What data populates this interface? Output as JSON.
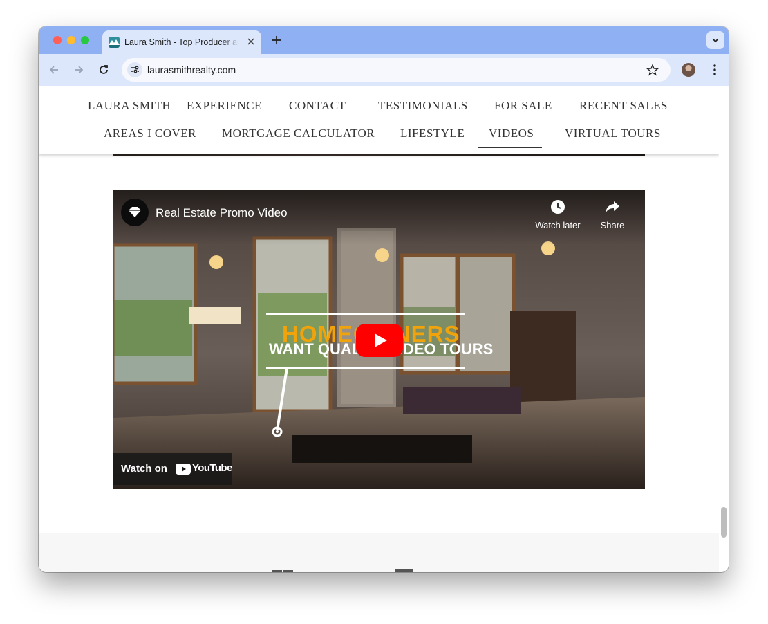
{
  "browser": {
    "tab": {
      "title": "Laura Smith - Top Producer and Real Estate Agent"
    },
    "address_bar": {
      "url": "laurasmithrealty.com"
    }
  },
  "site_nav": {
    "row1": [
      "LAURA SMITH",
      "EXPERIENCE",
      "CONTACT",
      "TESTIMONIALS",
      "FOR SALE",
      "RECENT SALES"
    ],
    "row2": [
      "AREAS I COVER",
      "MORTGAGE CALCULATOR",
      "LIFESTYLE",
      "VIDEOS",
      "VIRTUAL TOURS"
    ],
    "active": "VIDEOS"
  },
  "video": {
    "title": "Real Estate Promo Video",
    "watch_later": "Watch later",
    "share": "Share",
    "overlay_line1": "HOMEOWNERS",
    "overlay_line2": "WANT QUALITY VIDEO TOURS",
    "watch_on": "Watch on",
    "youtube_logo": "YouTube"
  },
  "colors": {
    "tab_strip": "#8fb0f3",
    "toolbar": "#dce7fb",
    "overlay_accent": "#f0a30a",
    "play_button": "#ff0000"
  }
}
